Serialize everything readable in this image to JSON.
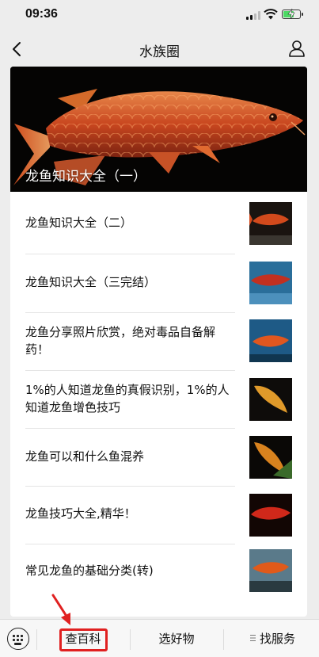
{
  "status_bar": {
    "time": "09:36",
    "battery_level": 0.7
  },
  "nav": {
    "title": "水族圈"
  },
  "hero": {
    "title": "龙鱼知识大全（一）"
  },
  "articles": [
    {
      "title": "龙鱼知识大全（二）"
    },
    {
      "title": "龙鱼知识大全（三完结）"
    },
    {
      "title": "龙鱼分享照片欣赏，绝对毒品自备解药！"
    },
    {
      "title": "1%的人知道龙鱼的真假识别，1%的人知道龙鱼增色技巧"
    },
    {
      "title": "龙鱼可以和什么鱼混养"
    },
    {
      "title": "龙鱼技巧大全,精华！"
    },
    {
      "title": "常见龙鱼的基础分类(转)"
    }
  ],
  "tab_bar": {
    "tab1": "查百科",
    "tab2": "选好物",
    "tab3": "找服务"
  },
  "colors": {
    "highlight": "#e02020",
    "background": "#ededed"
  }
}
